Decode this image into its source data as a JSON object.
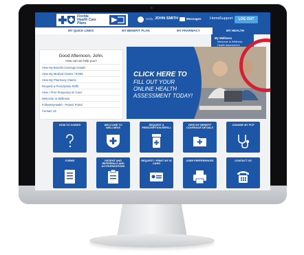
{
  "header": {
    "logo_lines": [
      "Florida",
      "Health Care",
      "Plans"
    ],
    "hello": "Hello,",
    "username": "JOHN SMITH",
    "messages": "Messages",
    "home": "Home",
    "support": "Support",
    "logout": "LOG OUT"
  },
  "nav": {
    "items": [
      "MY QUICK LINKS",
      "MY BENEFIT PLAN",
      "MY PHARMACY",
      "MY HEALTH"
    ]
  },
  "dropdown": {
    "title": "My Wellness",
    "items": [
      "Welcome to Wellness",
      "Health Assessment",
      "Printable Gym List",
      "FollowMyHealth"
    ]
  },
  "greeting": {
    "title": "Good Afternoon, John.",
    "subtitle": "How can we help you?",
    "links": [
      "View My Benefit Coverage Details",
      "View My Medical Claims / EOBs",
      "View My Pharmacy Claims",
      "Request a Prescription Refill",
      "View / Print Temporary ID Card",
      "Welcome to Wellness",
      "FollowMyHealth - Patient Portal",
      "Contact Us"
    ]
  },
  "banner": {
    "line1": "CLICK HERE TO",
    "line2": "FILL OUT YOUR",
    "line3": "ONLINE HEALTH",
    "line4": "ASSESSMENT TODAY!"
  },
  "tiles": [
    {
      "label": "HOW-TO GUIDES",
      "icon": "question-icon"
    },
    {
      "label": "WELCOME TO WELLNESS",
      "icon": "shield-plus-icon"
    },
    {
      "label": "REQUEST A PRESCRIPTION REFILL",
      "icon": "prescription-bottle-icon"
    },
    {
      "label": "VIEW MY BENEFIT COVERAGE DETAILS",
      "icon": "folder-plus-icon"
    },
    {
      "label": "CHANGE MY PCP",
      "icon": "stethoscope-icon"
    },
    {
      "label": "FORMS",
      "icon": "document-icon"
    },
    {
      "label": "PATIENT AND REFERRALS AND AUTHORIZATIONS",
      "icon": "clipboard-icon"
    },
    {
      "label": "REQUEST / PRINT MY ID CARD",
      "icon": "id-card-icon"
    },
    {
      "label": "USER PREFERENCES",
      "icon": "printer-icon"
    },
    {
      "label": "CONTACT US",
      "icon": "telephone-icon"
    }
  ],
  "colors": {
    "brand_blue": "#1d56a6",
    "logout_blue": "#4fa3e3",
    "highlight_red": "#d42032"
  }
}
